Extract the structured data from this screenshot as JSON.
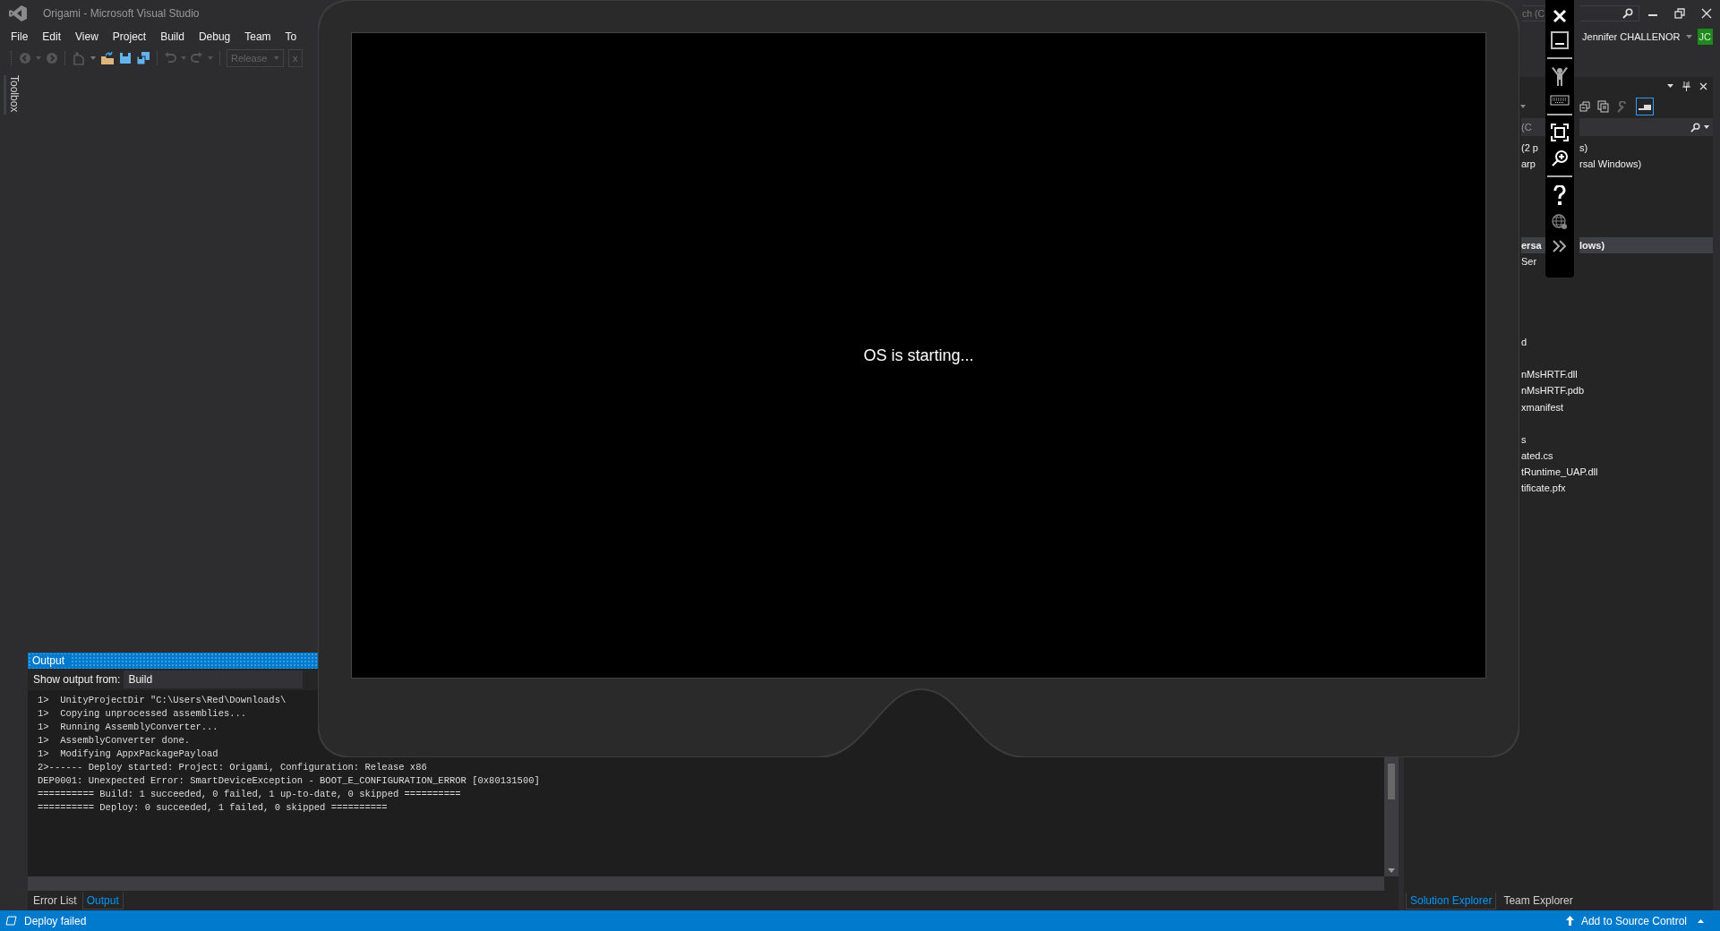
{
  "window": {
    "title": "Origami - Microsoft Visual Studio",
    "quick_launch": "ch (C",
    "user": "Jennifer CHALLENOR",
    "avatar": "JC"
  },
  "menu": [
    "File",
    "Edit",
    "View",
    "Project",
    "Build",
    "Debug",
    "Team",
    "To"
  ],
  "toolbar": {
    "configuration": "Release",
    "platform": "x"
  },
  "toolbox": "Toolbox",
  "emulator": {
    "status": "OS is starting..."
  },
  "output": {
    "title": "Output",
    "source_label": "Show output from:",
    "source": "Build",
    "lines": [
      "1>  UnityProjectDir \"C:\\Users\\Red\\Downloads\\",
      "1>  Copying unprocessed assemblies...",
      "1>  Running AssemblyConverter...",
      "1>  AssemblyConverter done.",
      "1>  Modifying AppxPackagePayload",
      "2>------ Deploy started: Project: Origami, Configuration: Release x86",
      "DEP0001: Unexpected Error: SmartDeviceException - BOOT_E_CONFIGURATION_ERROR [0x80131500]",
      "========== Build: 1 succeeded, 0 failed, 1 up-to-date, 0 skipped ==========",
      "========== Deploy: 0 succeeded, 1 failed, 0 skipped =========="
    ]
  },
  "bottom_tabs": [
    {
      "label": "Error List",
      "selected": false
    },
    {
      "label": "Output",
      "selected": true
    }
  ],
  "solution_explorer": {
    "search": "(C",
    "rows": [
      {
        "text": "(2 p",
        "text_after": "s)",
        "selected": false
      },
      {
        "text": "arp",
        "text_after": "rsal Windows)",
        "selected": false
      },
      {
        "text": "ersa",
        "text_after": "lows)",
        "selected": true
      },
      {
        "text": "Ser",
        "selected": false
      },
      {
        "text": "d",
        "selected": false
      },
      {
        "text": "nMsHRTF.dll",
        "selected": false
      },
      {
        "text": "nMsHRTF.pdb",
        "selected": false
      },
      {
        "text": "xmanifest",
        "selected": false
      },
      {
        "text": "s",
        "selected": false
      },
      {
        "text": "ated.cs",
        "selected": false
      },
      {
        "text": "tRuntime_UAP.dll",
        "selected": false
      },
      {
        "text": "tificate.pfx",
        "selected": false
      }
    ]
  },
  "side_tabs": [
    {
      "label": "Solution Explorer",
      "selected": true
    },
    {
      "label": "Team Explorer",
      "selected": false
    }
  ],
  "status_bar": {
    "message": "Deploy failed",
    "action": "Add to Source Control"
  }
}
